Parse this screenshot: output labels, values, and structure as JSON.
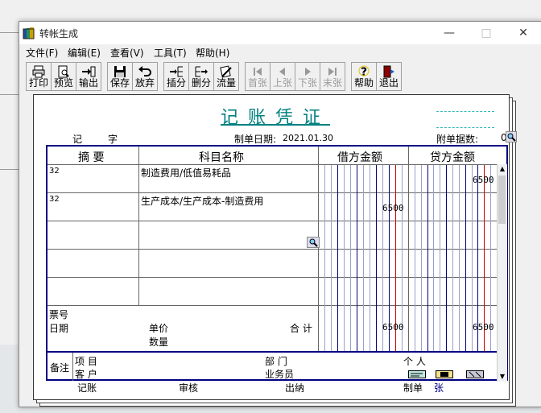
{
  "window": {
    "title": "转帐生成",
    "minimize": "—",
    "maximize": "□",
    "close": "✕"
  },
  "menu": [
    "文件(F)",
    "编辑(E)",
    "查看(V)",
    "工具(T)",
    "帮助(H)"
  ],
  "toolbar": [
    {
      "label": "打印",
      "icon": "printer-icon",
      "enabled": true
    },
    {
      "label": "预览",
      "icon": "preview-icon",
      "enabled": true
    },
    {
      "label": "输出",
      "icon": "export-icon",
      "enabled": true
    },
    {
      "label": "保存",
      "icon": "save-icon",
      "enabled": true
    },
    {
      "label": "放弃",
      "icon": "undo-icon",
      "enabled": true
    },
    {
      "label": "插分",
      "icon": "insert-row-icon",
      "enabled": true
    },
    {
      "label": "删分",
      "icon": "delete-row-icon",
      "enabled": true
    },
    {
      "label": "流量",
      "icon": "cashflow-icon",
      "enabled": true
    },
    {
      "label": "首张",
      "icon": "first-icon",
      "enabled": false
    },
    {
      "label": "上张",
      "icon": "prev-icon",
      "enabled": false
    },
    {
      "label": "下张",
      "icon": "next-icon",
      "enabled": false
    },
    {
      "label": "末张",
      "icon": "last-icon",
      "enabled": false
    },
    {
      "label": "帮助",
      "icon": "help-icon",
      "enabled": true
    },
    {
      "label": "退出",
      "icon": "exit-icon",
      "enabled": true
    }
  ],
  "voucher": {
    "title": "记账凭证",
    "type_label": "记",
    "number_label": "字",
    "date_label": "制单日期:",
    "date": "2021.01.30",
    "attach_label": "附单据数:",
    "attach_count": "0",
    "columns": {
      "summary": "摘 要",
      "account": "科目名称",
      "debit": "借方金额",
      "credit": "贷方金额"
    },
    "rows": [
      {
        "summary": "32",
        "account": "制造费用/低值易耗品",
        "debit": "",
        "credit": "6500"
      },
      {
        "summary": "32",
        "account": "生产成本/生产成本-制造费用",
        "debit": "6500",
        "credit": ""
      },
      {
        "summary": "",
        "account": "",
        "debit": "",
        "credit": ""
      },
      {
        "summary": "",
        "account": "",
        "debit": "",
        "credit": ""
      },
      {
        "summary": "",
        "account": "",
        "debit": "",
        "credit": ""
      }
    ],
    "footer_left": {
      "ticket": "票号",
      "date": "日期",
      "unit_price": "单价",
      "quantity": "数量"
    },
    "total_label": "合 计",
    "total_debit": "6500",
    "total_credit": "6500",
    "remark_label": "备注",
    "project_label": "项  目",
    "customer_label": "客  户",
    "dept_label": "部  门",
    "salesman_label": "业务员",
    "person_label": "个  人",
    "bottom": {
      "bookkeep": "记账",
      "audit": "审核",
      "cashier": "出纳",
      "maker": "制单",
      "maker_name": "张"
    }
  },
  "colors": {
    "teal": "#008080",
    "navy": "#000080",
    "red": "#cc0000"
  }
}
